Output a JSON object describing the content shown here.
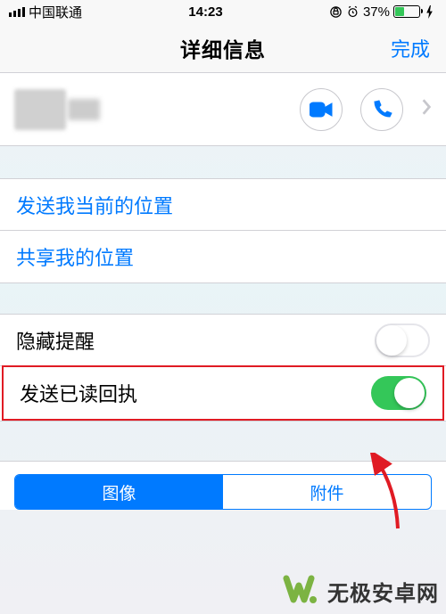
{
  "status": {
    "carrier": "中国联通",
    "time": "14:23",
    "battery_pct": "37%"
  },
  "nav": {
    "title": "详细信息",
    "done": "完成"
  },
  "location": {
    "send_current": "发送我当前的位置",
    "share": "共享我的位置"
  },
  "settings": {
    "hide_alerts": {
      "label": "隐藏提醒",
      "on": false
    },
    "read_receipts": {
      "label": "发送已读回执",
      "on": true
    }
  },
  "tabs": {
    "images": "图像",
    "attachments": "附件"
  },
  "watermark": "无极安卓网"
}
